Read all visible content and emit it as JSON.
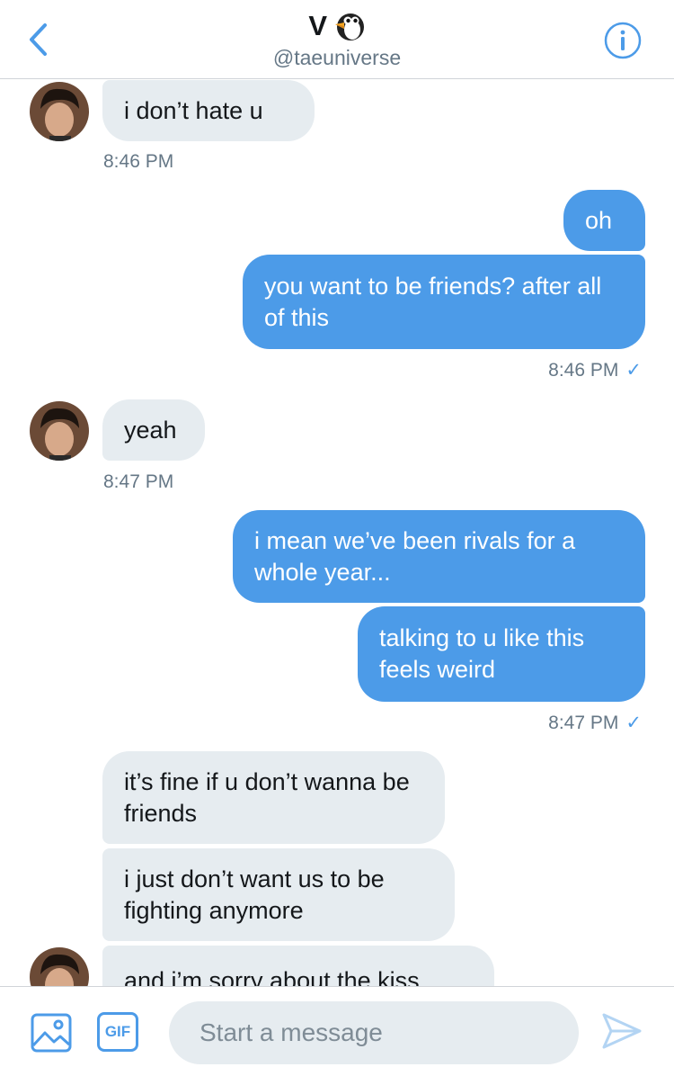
{
  "header": {
    "title": "V",
    "title_emoji": "penguin-icon",
    "handle": "@taeuniverse"
  },
  "colors": {
    "accent": "#4c9be8",
    "incoming_bubble": "#e6ecf0",
    "timestamp": "#657786"
  },
  "messages": [
    {
      "direction": "incoming",
      "text": "i don’t hate u"
    },
    {
      "direction": "incoming_timestamp",
      "text": "8:46 PM"
    },
    {
      "direction": "outgoing",
      "text": "oh"
    },
    {
      "direction": "outgoing",
      "text": "you want to be friends? after all of this"
    },
    {
      "direction": "outgoing_timestamp",
      "text": "8:46 PM",
      "status": "✓"
    },
    {
      "direction": "incoming",
      "text": "yeah"
    },
    {
      "direction": "incoming_timestamp",
      "text": "8:47 PM"
    },
    {
      "direction": "outgoing",
      "text": "i mean we’ve been rivals for a whole year..."
    },
    {
      "direction": "outgoing",
      "text": "talking to u like this feels weird"
    },
    {
      "direction": "outgoing_timestamp",
      "text": "8:47 PM",
      "status": "✓"
    },
    {
      "direction": "incoming",
      "text": "it’s fine if u don’t wanna be friends"
    },
    {
      "direction": "incoming",
      "text": "i just don’t want us to be fighting anymore"
    },
    {
      "direction": "incoming",
      "text": "and i’m sorry about the kiss"
    }
  ],
  "composer": {
    "placeholder": "Start a message",
    "gif_label": "GIF"
  }
}
